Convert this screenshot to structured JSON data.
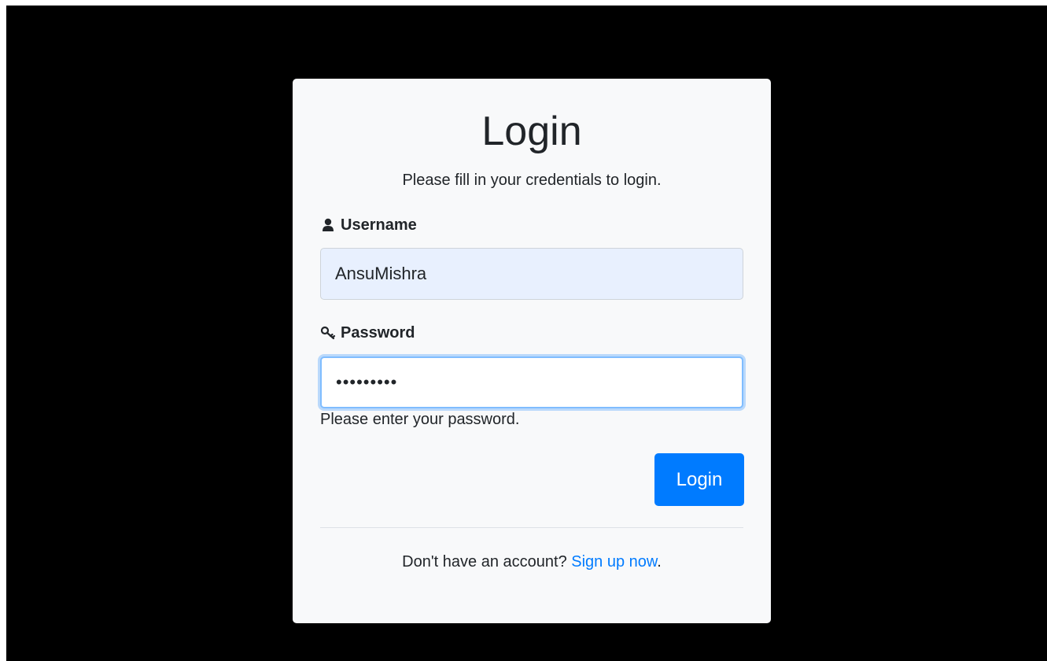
{
  "login": {
    "title": "Login",
    "subtitle": "Please fill in your credentials to login.",
    "username_label": "Username",
    "username_value": "AnsuMishra",
    "password_label": "Password",
    "password_value": "•••••••••",
    "password_help": "Please enter your password.",
    "submit_label": "Login",
    "footer_text": "Don't have an account?",
    "signup_link": "Sign up now",
    "footer_end": "."
  },
  "colors": {
    "accent": "#007bff",
    "card_bg": "#f8f9fa",
    "backdrop": "#000000",
    "autofill_bg": "#e8f0fe"
  },
  "icons": {
    "username": "user-icon",
    "password": "key-icon"
  }
}
